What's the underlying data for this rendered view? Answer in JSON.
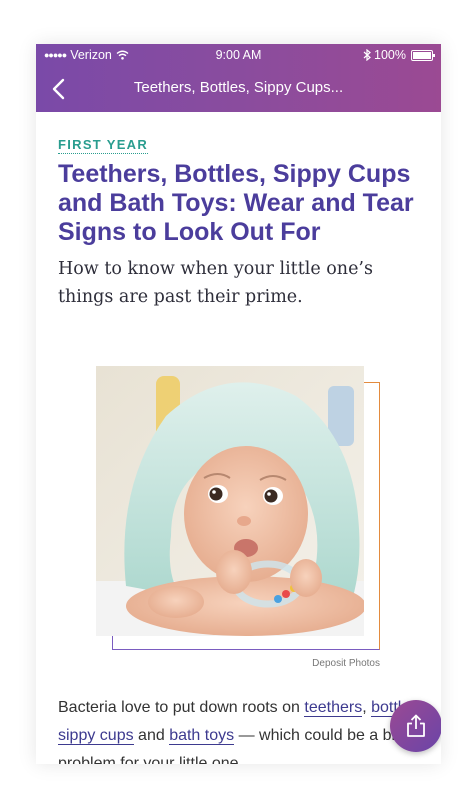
{
  "status_bar": {
    "carrier": "Verizon",
    "time": "9:00 AM",
    "battery": "100%"
  },
  "nav": {
    "title": "Teethers, Bottles, Sippy Cups..."
  },
  "article": {
    "category": "FIRST YEAR",
    "title": "Teethers, Bottles, Sippy Cups and Bath Toys: Wear and Tear Signs to Look Out For",
    "subtitle": "How to know when your little one’s things are past their prime.",
    "image_credit": "Deposit Photos",
    "body": {
      "text_1": "Bacteria love to put down roots on ",
      "link_1": "teethers",
      "text_2": ", ",
      "link_2": "bottles",
      "text_3": ", ",
      "link_3": "sippy cups",
      "text_4": " and ",
      "link_4": "bath toys",
      "text_5": " — which could be a big problem for your little one"
    }
  },
  "colors": {
    "header_gradient_start": "#7a4aa8",
    "header_gradient_end": "#9b4a93",
    "category": "#2a9d8f",
    "title": "#4b3d9c",
    "frame_orange": "#e38b3e",
    "frame_purple": "#7a5cc0"
  },
  "icons": {
    "back": "chevron-left-icon",
    "share": "share-icon",
    "wifi": "wifi-icon",
    "bluetooth": "bluetooth-icon",
    "battery": "battery-icon"
  }
}
